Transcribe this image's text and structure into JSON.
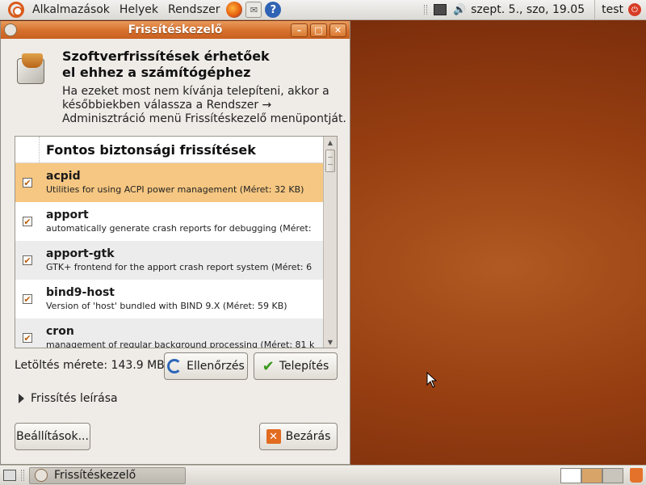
{
  "top_panel": {
    "menus": [
      "Alkalmazások",
      "Helyek",
      "Rendszer"
    ],
    "clock": "szept.  5., szo, 19.05",
    "user": "test"
  },
  "window": {
    "title": "Frissítéskezelő",
    "controls": {
      "minimize": "–",
      "maximize": "□",
      "close": "✕"
    },
    "heading_line1": "Szoftverfrissítések érhetőek",
    "heading_line2": "el ehhez a számítógéphez",
    "info_line1": "Ha ezeket most nem kívánja telepíteni, akkor a",
    "info_line2": "későbbiekben válassza a Rendszer →",
    "info_line3": "Adminisztráció menü Frissítéskezelő menüpontját.",
    "list": {
      "section_title": "Fontos biztonsági frissítések",
      "items": [
        {
          "name": "acpid",
          "desc": "Utilities for using ACPI power management (Méret: 32 KB)",
          "checked": true
        },
        {
          "name": "apport",
          "desc": "automatically generate crash reports for debugging (Méret:",
          "checked": true
        },
        {
          "name": "apport-gtk",
          "desc": "GTK+ frontend for the apport crash report system (Méret: 6",
          "checked": true
        },
        {
          "name": "bind9-host",
          "desc": "Version of 'host' bundled with BIND 9.X (Méret: 59 KB)",
          "checked": true
        },
        {
          "name": "cron",
          "desc": "management of regular background processing (Méret: 81 k",
          "checked": true
        }
      ]
    },
    "download_size": "Letöltés mérete: 143.9 MB",
    "check_button": "Ellenőrzés",
    "install_button": "Telepítés",
    "description_expander": "Frissítés leírása",
    "settings_button": "Beállítások...",
    "close_button": "Bezárás"
  },
  "bottom_panel": {
    "task_label": "Frissítéskezelő"
  },
  "colors": {
    "titlebar": "#d66f2c",
    "selected_row": "#f6c782",
    "desktop": "#983f12"
  }
}
